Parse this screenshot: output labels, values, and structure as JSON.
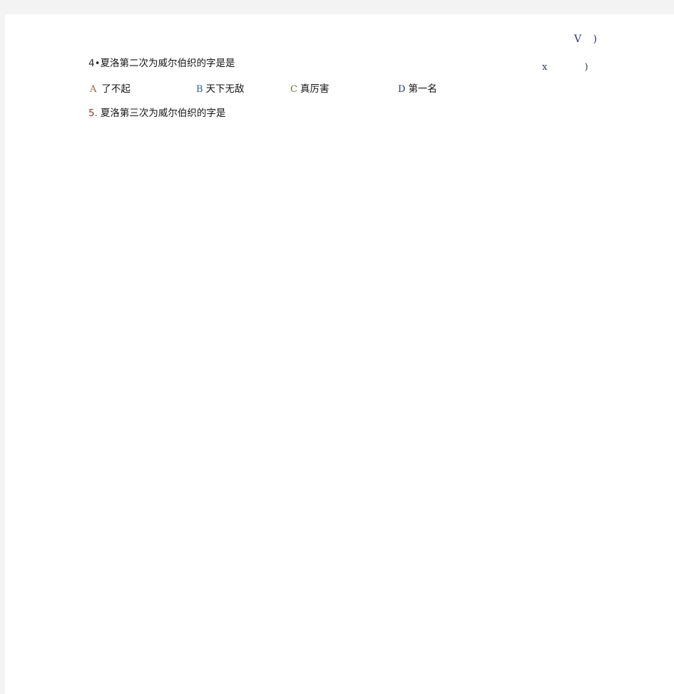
{
  "page": {
    "background_color": "#f3f3f3",
    "sheet_color": "#ffffff"
  },
  "marks": {
    "check_mark": "V  )",
    "cross_mark": "x )"
  },
  "questions": [
    {
      "number": "4•",
      "text": "夏洛第二次为威尔伯织的字是是",
      "options": [
        {
          "letter": "A",
          "text": "了不起"
        },
        {
          "letter": "B",
          "text": "天下无敌"
        },
        {
          "letter": "C",
          "text": "真厉害"
        },
        {
          "letter": "D",
          "text": "第一名"
        }
      ]
    },
    {
      "number": "5.",
      "text": "夏洛第三次为威尔伯织的字是",
      "options": []
    }
  ]
}
